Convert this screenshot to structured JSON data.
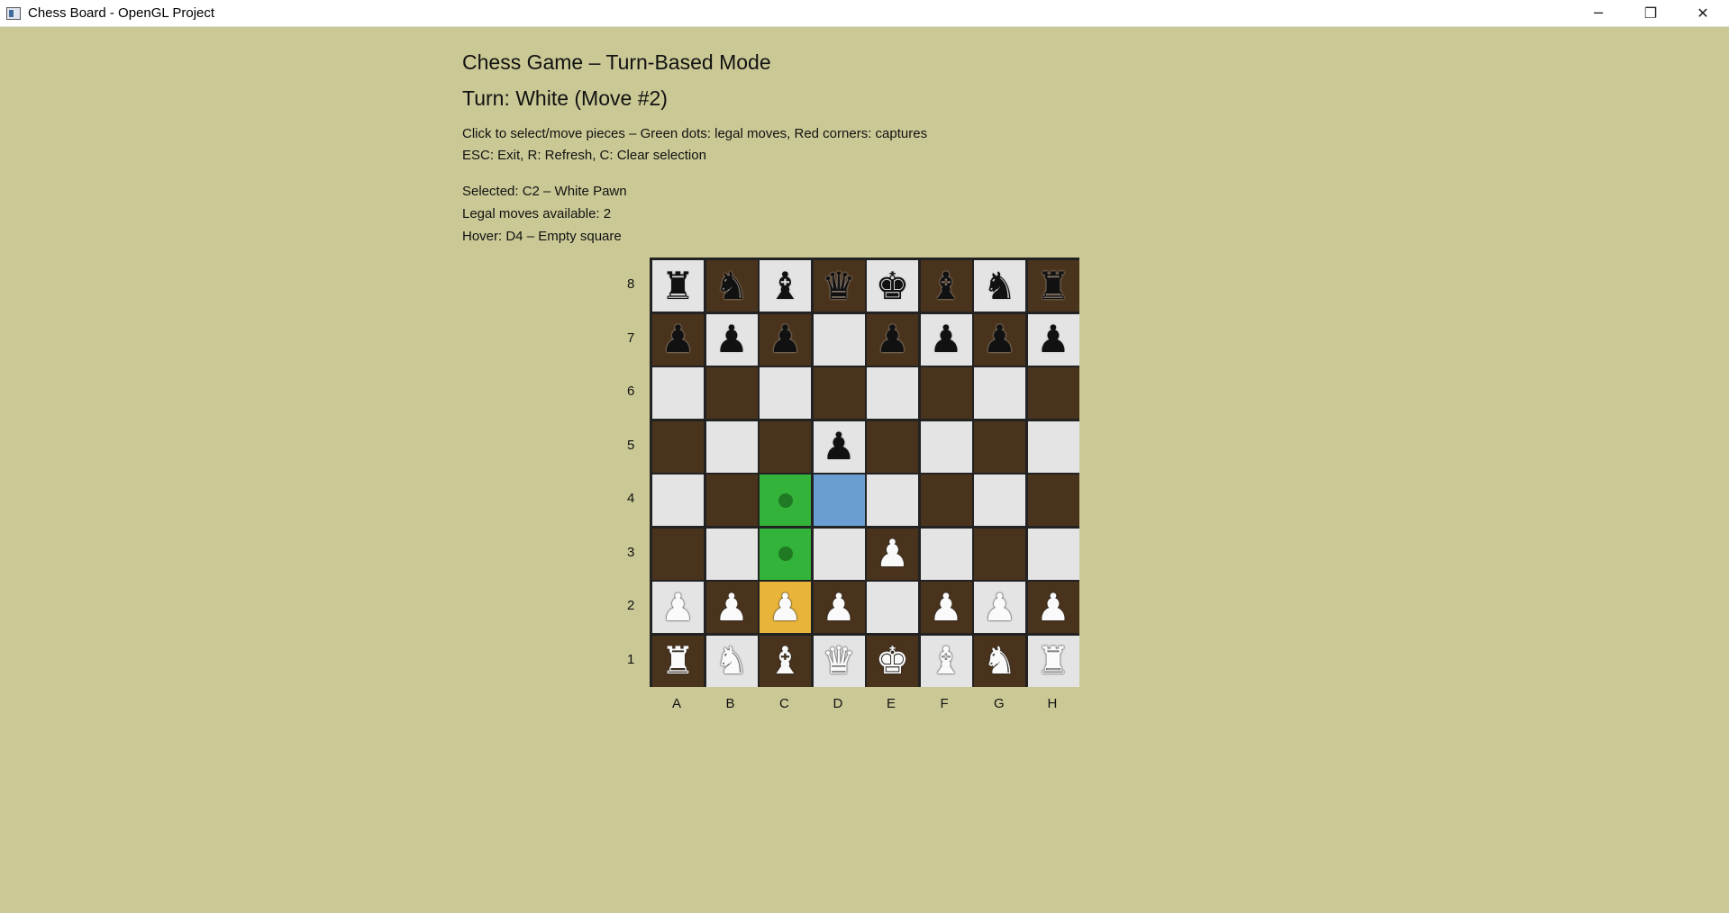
{
  "window": {
    "title": "Chess Board - OpenGL Project",
    "minimize_glyph": "─",
    "restore_glyph": "❐",
    "close_glyph": "✕"
  },
  "info": {
    "heading": "Chess Game – Turn-Based Mode",
    "turn": "Turn: White (Move #2)",
    "instructions": "Click to select/move pieces – Green dots: legal moves, Red corners: captures",
    "keys": "ESC: Exit, R: Refresh, C: Clear selection",
    "selected": "Selected: C2 – White Pawn",
    "legal_moves": "Legal moves available: 2",
    "hover": "Hover: D4 – Empty square"
  },
  "board": {
    "files": [
      "A",
      "B",
      "C",
      "D",
      "E",
      "F",
      "G",
      "H"
    ],
    "ranks": [
      "8",
      "7",
      "6",
      "5",
      "4",
      "3",
      "2",
      "1"
    ],
    "pieces": {
      "A8": "br",
      "B8": "bn",
      "C8": "bb",
      "D8": "bq",
      "E8": "bk",
      "F8": "bb",
      "G8": "bn",
      "H8": "br",
      "A7": "bp",
      "B7": "bp",
      "C7": "bp",
      "E7": "bp",
      "F7": "bp",
      "G7": "bp",
      "H7": "bp",
      "D5": "bp",
      "E3": "wp",
      "A2": "wp",
      "B2": "wp",
      "C2": "wp",
      "D2": "wp",
      "F2": "wp",
      "G2": "wp",
      "H2": "wp",
      "A1": "wr",
      "B1": "wn",
      "C1": "wb",
      "D1": "wq",
      "E1": "wk",
      "F1": "wb",
      "G1": "wn",
      "H1": "wr"
    },
    "selected_square": "C2",
    "hover_square": "D4",
    "legal_moves": [
      "C3",
      "C4"
    ]
  },
  "colors": {
    "background": "#cac996",
    "light_square": "#e4e4e4",
    "dark_square": "#4a331c",
    "legal_square": "#33b33a",
    "selected_square": "#e8b43a",
    "hover_square": "#6a9dd1"
  }
}
